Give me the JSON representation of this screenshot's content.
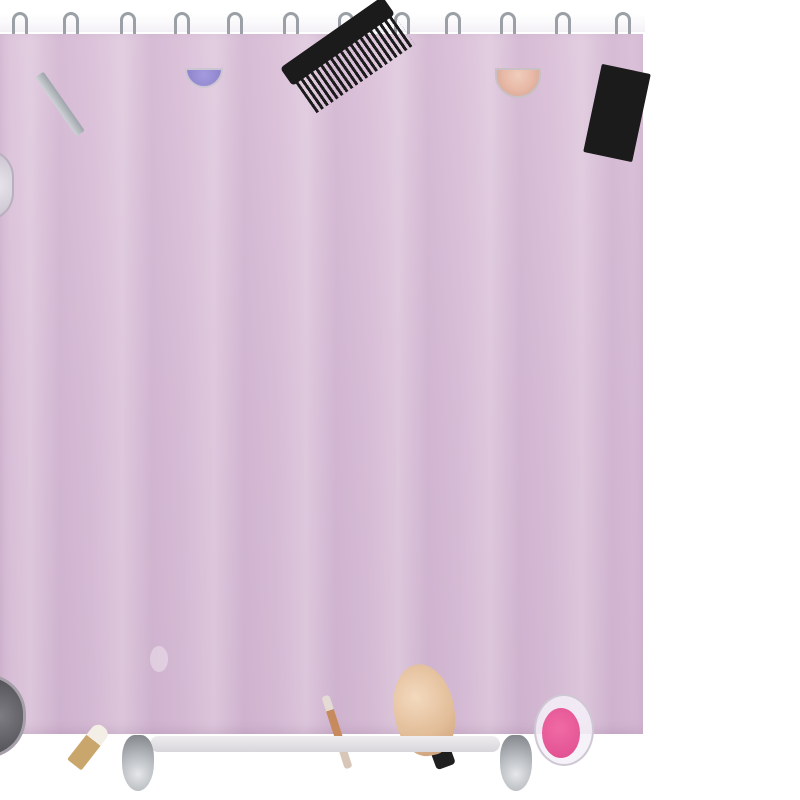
{
  "image": {
    "subject_items": [
      "shower-curtain",
      "curtain-rings",
      "black-comb",
      "black-comb-2",
      "makeup-brush",
      "blush-compact",
      "eyeshadow-compacts",
      "lipstick",
      "tweezers",
      "stand-feet"
    ],
    "colors": {
      "curtain": "#d8bfd7",
      "comb": "#1b1b1b",
      "blush": "#e85a98",
      "brush": "#e2bd98"
    }
  }
}
